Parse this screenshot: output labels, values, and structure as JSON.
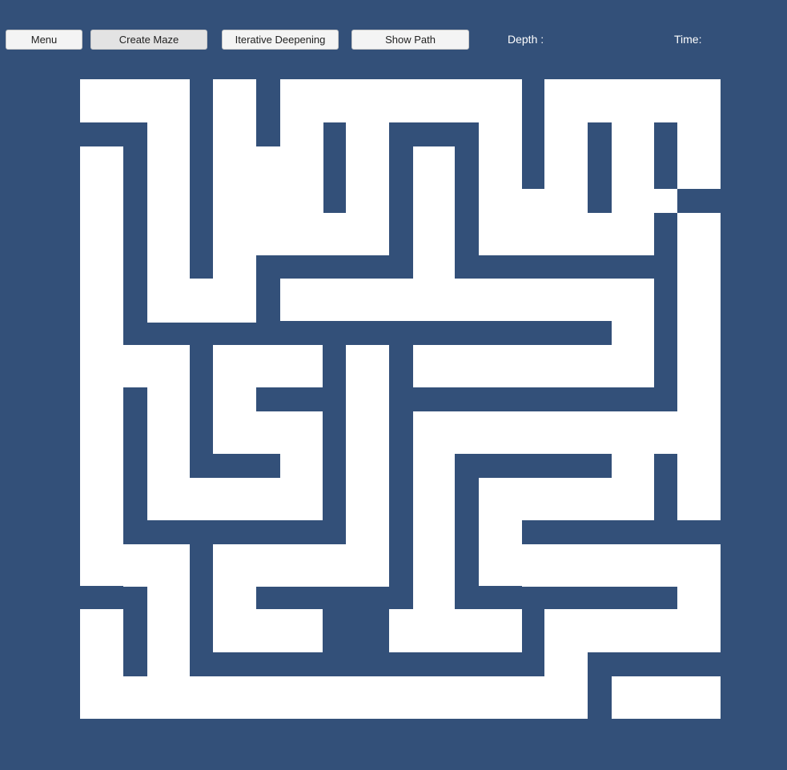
{
  "toolbar": {
    "menu_label": "Menu",
    "create_maze_label": "Create Maze",
    "iterative_deepening_label": "Iterative Deepening",
    "show_path_label": "Show Path"
  },
  "status": {
    "depth_label": "Depth :",
    "time_label": "Time:"
  },
  "colors": {
    "background": "#335079",
    "maze_path": "#ffffff",
    "button_face": "#f4f4f4"
  },
  "maze": {
    "columns": 29,
    "rows": 29
  }
}
